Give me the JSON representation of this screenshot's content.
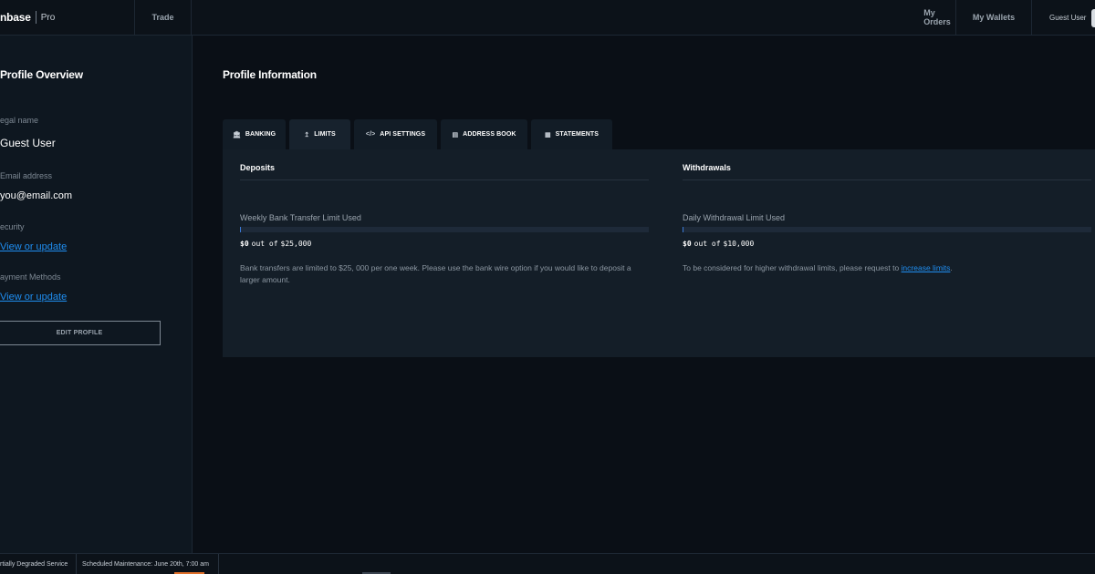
{
  "header": {
    "brand_name": "nbase",
    "brand_suffix": "Pro",
    "nav": {
      "trade": "Trade",
      "orders": "My Orders",
      "wallets": "My Wallets",
      "user": "Guest User"
    }
  },
  "sidebar": {
    "title": "Profile Overview",
    "legal_name_label": "egal name",
    "legal_name_value": "Guest User",
    "email_label": "Email address",
    "email_value": "you@email.com",
    "security_label": "ecurity",
    "security_link": "View or update",
    "payment_label": "ayment Methods",
    "payment_link": "View or update",
    "edit_button": "EDIT PROFILE"
  },
  "main": {
    "title": "Profile Information",
    "tabs": [
      {
        "label": "BANKING",
        "icon": "bank-icon"
      },
      {
        "label": "LIMITS",
        "icon": "upload-icon"
      },
      {
        "label": "API SETTINGS",
        "icon": "code-icon"
      },
      {
        "label": "ADDRESS BOOK",
        "icon": "book-icon"
      },
      {
        "label": "STATEMENTS",
        "icon": "document-icon"
      }
    ],
    "active_tab": "LIMITS",
    "deposits": {
      "heading": "Deposits",
      "limit_label": "Weekly Bank Transfer Limit Used",
      "used": "$0",
      "of_word": "out of",
      "total": "$25,000",
      "used_fraction": 0.002,
      "note": "Bank transfers are limited to $25, 000 per one week. Please use the bank wire option if you would like to deposit a larger amount."
    },
    "withdrawals": {
      "heading": "Withdrawals",
      "limit_label": "Daily Withdrawal Limit Used",
      "used": "$0",
      "of_word": "out of",
      "total": "$10,000",
      "used_fraction": 0.002,
      "note_prefix": "To be considered for higher withdrawal limits, please request to ",
      "note_link": "increase limits",
      "note_suffix": "."
    }
  },
  "footer": {
    "status": "rtially Degraded Service",
    "maintenance": "Scheduled Maintenance: June 20th, 7:00 am"
  },
  "colors": {
    "accent_link": "#1f8ef1",
    "bar_fill": "#3a79d6",
    "status_orange": "#e0702a"
  }
}
